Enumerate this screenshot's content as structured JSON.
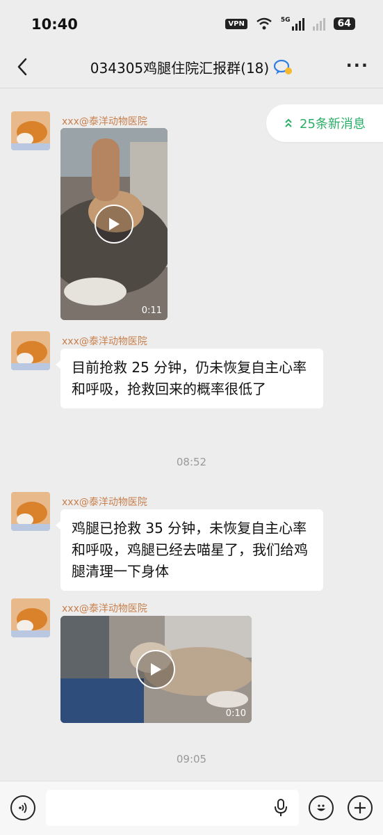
{
  "status_bar": {
    "time": "10:40",
    "vpn": "VPN",
    "network": "5G",
    "battery": "64"
  },
  "nav": {
    "title": "034305鸡腿住院汇报群(18)"
  },
  "new_messages": {
    "label": "25条新消息"
  },
  "messages": [
    {
      "type": "video",
      "sender": "xxx@泰洋动物医院",
      "duration": "0:11"
    },
    {
      "type": "text",
      "sender": "xxx@泰洋动物医院",
      "text": "目前抢救 25 分钟，仍未恢复自主心率和呼吸，抢救回来的概率很低了"
    },
    {
      "type": "time",
      "text": "08:52"
    },
    {
      "type": "text",
      "sender": "xxx@泰洋动物医院",
      "text": "鸡腿已抢救 35 分钟，未恢复自主心率和呼吸，鸡腿已经去喵星了，我们给鸡腿清理一下身体"
    },
    {
      "type": "video",
      "sender": "xxx@泰洋动物医院",
      "duration": "0:10"
    },
    {
      "type": "time",
      "text": "09:05"
    }
  ],
  "input": {
    "value": ""
  },
  "colors": {
    "sender": "#c97f4b",
    "accent_green": "#2aae67",
    "background": "#ededed"
  }
}
